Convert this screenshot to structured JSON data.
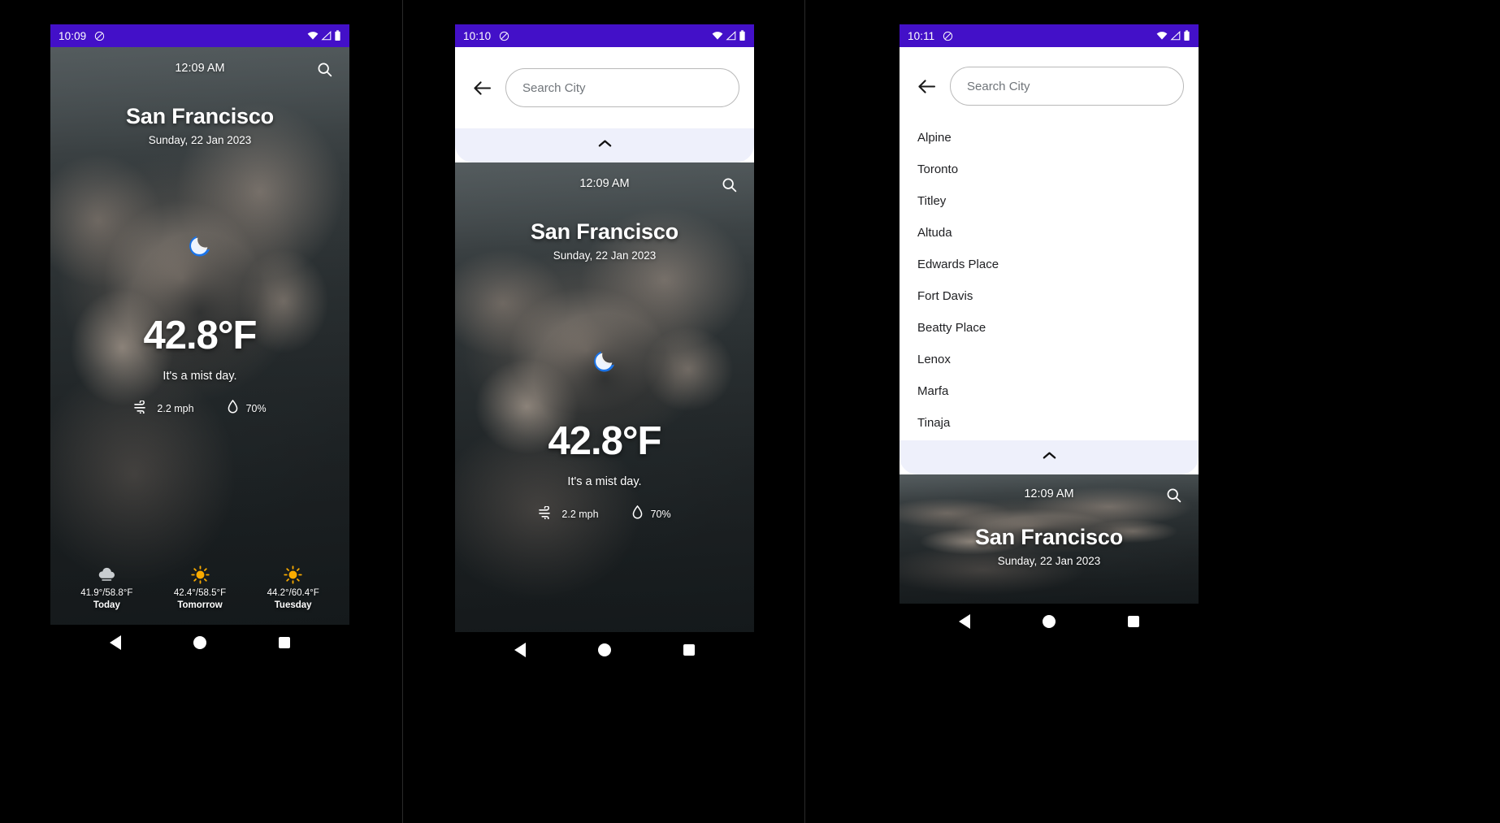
{
  "app": {
    "name": "Weather App",
    "accent_purple": "#4310c8",
    "sheet_handle_bg": "#eef0fb",
    "text_dark": "#202124",
    "placeholder_color": "#70757a"
  },
  "phones": [
    {
      "id": "phone-1-home",
      "status_bar": {
        "time": "10:09",
        "notification_icon": "do-not-disturb-icon",
        "wifi_icon": "wifi-icon",
        "signal_icon": "signal-icon",
        "battery_icon": "battery-icon"
      },
      "weather": {
        "time": "12:09 AM",
        "city": "San Francisco",
        "date": "Sunday, 22 Jan 2023",
        "condition_icon": "crescent-moon-icon",
        "temperature": "42.8°F",
        "description": "It's a mist day.",
        "wind_icon": "wind-icon",
        "wind": "2.2 mph",
        "humidity_icon": "water-drop-icon",
        "humidity": "70%",
        "search_icon": "search-icon",
        "forecast": [
          {
            "icon": "cloud-icon",
            "temps": "41.9°/58.8°F",
            "day": "Today"
          },
          {
            "icon": "sun-icon",
            "temps": "42.4°/58.5°F",
            "day": "Tomorrow"
          },
          {
            "icon": "sun-icon",
            "temps": "44.2°/60.4°F",
            "day": "Tuesday"
          }
        ]
      },
      "nav_bar": {
        "back": "nav-back-icon",
        "home": "nav-home-icon",
        "recents": "nav-recents-icon"
      }
    },
    {
      "id": "phone-2-search-open",
      "status_bar": {
        "time": "10:10",
        "notification_icon": "do-not-disturb-icon",
        "wifi_icon": "wifi-icon",
        "signal_icon": "signal-icon",
        "battery_icon": "battery-icon"
      },
      "search": {
        "back_icon": "back-arrow-icon",
        "placeholder": "Search City",
        "value": "",
        "collapse_icon": "chevron-up-icon"
      },
      "weather": {
        "time": "12:09 AM",
        "city": "San Francisco",
        "date": "Sunday, 22 Jan 2023",
        "condition_icon": "crescent-moon-icon",
        "temperature": "42.8°F",
        "description": "It's a mist day.",
        "wind_icon": "wind-icon",
        "wind": "2.2 mph",
        "humidity_icon": "water-drop-icon",
        "humidity": "70%",
        "search_icon": "search-icon"
      },
      "nav_bar": {
        "back": "nav-back-icon",
        "home": "nav-home-icon",
        "recents": "nav-recents-icon"
      }
    },
    {
      "id": "phone-3-city-list",
      "status_bar": {
        "time": "10:11",
        "notification_icon": "do-not-disturb-icon",
        "wifi_icon": "wifi-icon",
        "signal_icon": "signal-icon",
        "battery_icon": "battery-icon"
      },
      "search": {
        "back_icon": "back-arrow-icon",
        "placeholder": "Search City",
        "value": "",
        "collapse_icon": "chevron-up-icon"
      },
      "cities": [
        "Alpine",
        "Toronto",
        "Titley",
        "Altuda",
        "Edwards Place",
        "Fort Davis",
        "Beatty Place",
        "Lenox",
        "Marfa",
        "Tinaja"
      ],
      "weather_peek": {
        "time": "12:09 AM",
        "city": "San Francisco",
        "date": "Sunday, 22 Jan 2023",
        "search_icon": "search-icon"
      },
      "nav_bar": {
        "back": "nav-back-icon",
        "home": "nav-home-icon",
        "recents": "nav-recents-icon"
      }
    }
  ]
}
